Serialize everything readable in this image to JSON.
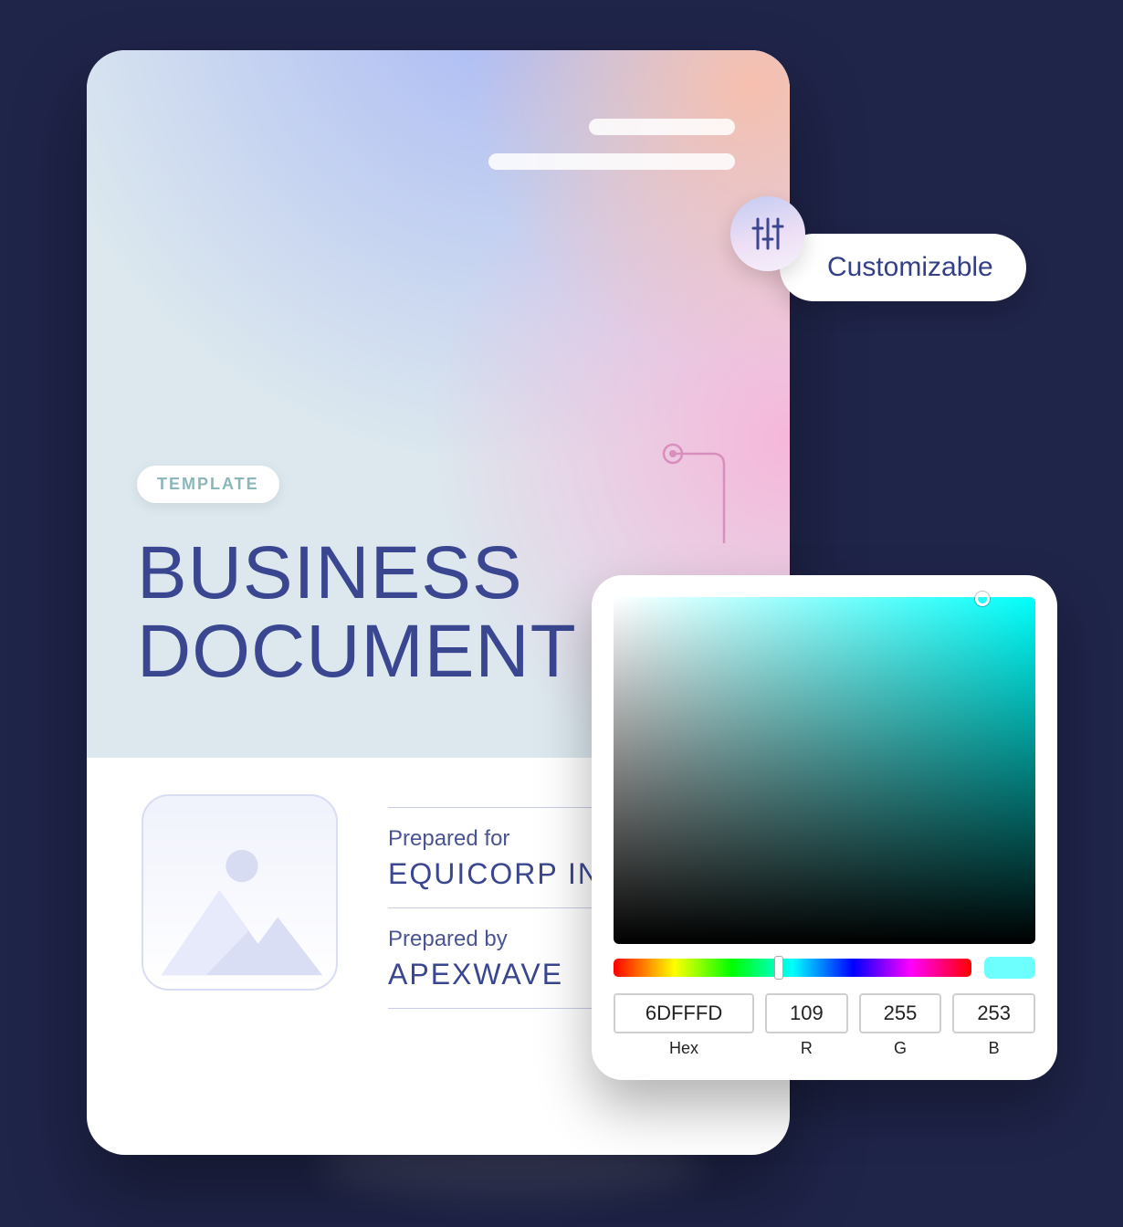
{
  "document": {
    "badge": "TEMPLATE",
    "title": "BUSINESS\nDOCUMENT",
    "prepared_for_label": "Prepared for",
    "prepared_for_value": "EQUICORP INC.",
    "prepared_by_label": "Prepared by",
    "prepared_by_value": "APEXWAVE"
  },
  "custom_chip": {
    "label": "Customizable",
    "icon": "sliders-icon"
  },
  "color_picker": {
    "hex_label": "Hex",
    "hex_value": "6DFFFD",
    "r_label": "R",
    "r_value": "109",
    "g_label": "G",
    "g_value": "255",
    "b_label": "B",
    "b_value": "253",
    "swatch_color": "#6DFFFD"
  },
  "colors": {
    "brand_text": "#3a4790",
    "page_bg": "#1f2449"
  }
}
